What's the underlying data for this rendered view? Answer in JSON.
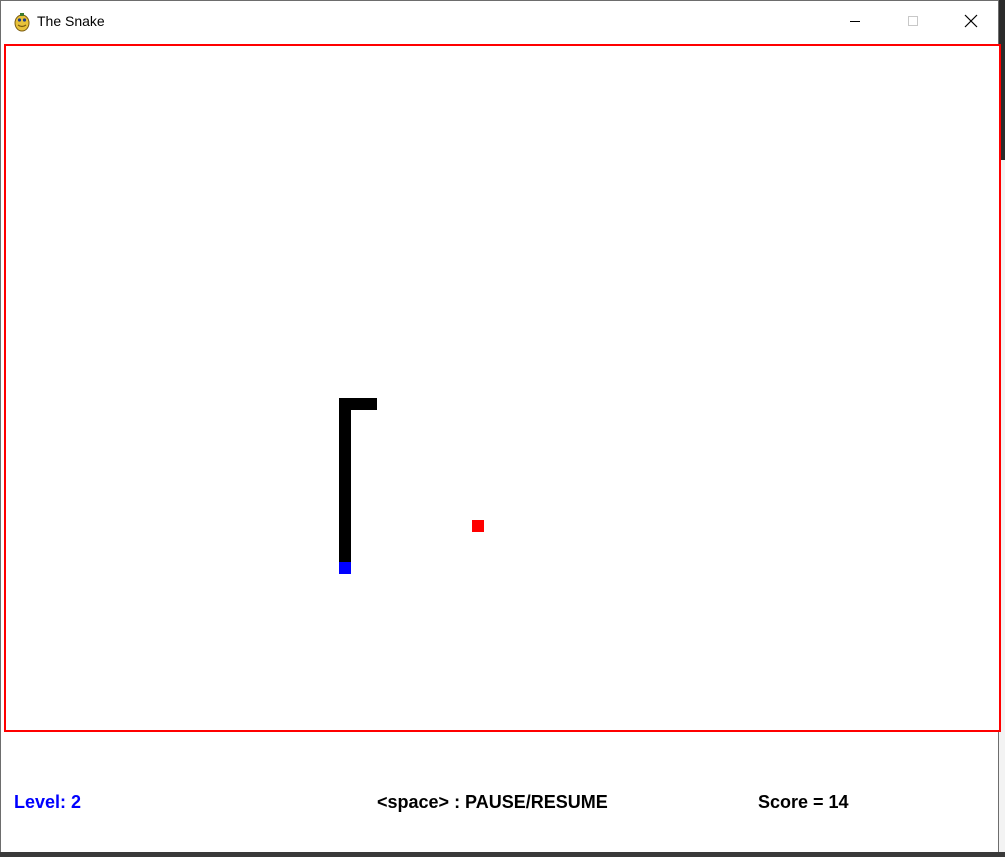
{
  "window": {
    "title": "The Snake",
    "icon": "pygame-snake-icon",
    "controls": {
      "minimize_icon": "minimize-icon",
      "maximize_icon": "maximize-icon",
      "close_icon": "close-icon"
    }
  },
  "game": {
    "border_color": "#ff0000",
    "snake_color": "#000000",
    "snake_head_color": "#0000ff",
    "food_color": "#ff0000"
  },
  "status": {
    "level": "Level: 2",
    "level_color": "#0000ff",
    "hint": "<space> : PAUSE/RESUME",
    "score": "Score = 14"
  }
}
